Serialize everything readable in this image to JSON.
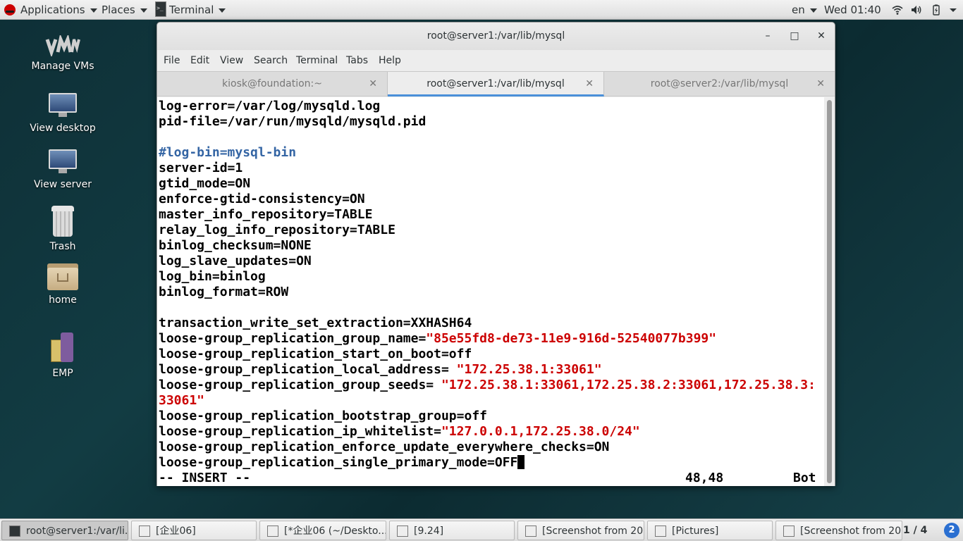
{
  "top_panel": {
    "applications_label": "Applications",
    "places_label": "Places",
    "terminal_label": "Terminal",
    "language": "en",
    "clock": "Wed 01:40"
  },
  "desktop_icons": [
    {
      "label": "Manage VMs",
      "icon": "vm-manager-icon"
    },
    {
      "label": "View desktop",
      "icon": "monitor-icon"
    },
    {
      "label": "View server",
      "icon": "monitor-icon"
    },
    {
      "label": "Trash",
      "icon": "trash-icon"
    },
    {
      "label": "home",
      "icon": "home-folder-icon"
    },
    {
      "label": "EMP",
      "icon": "emp-icon"
    }
  ],
  "window": {
    "title": "root@server1:/var/lib/mysql",
    "minimize": "–",
    "maximize": "□",
    "close": "✕"
  },
  "menu": [
    "File",
    "Edit",
    "View",
    "Search",
    "Terminal",
    "Tabs",
    "Help"
  ],
  "tabs": [
    {
      "label": "kiosk@foundation:~",
      "close": "✕"
    },
    {
      "label": "root@server1:/var/lib/mysql",
      "close": "✕"
    },
    {
      "label": "root@server2:/var/lib/mysql",
      "close": "✕"
    }
  ],
  "terminal": {
    "lines": [
      "log-error=/var/log/mysqld.log",
      "pid-file=/var/run/mysqld/mysqld.pid",
      "",
      "#log-bin=mysql-bin",
      "server-id=1",
      "gtid_mode=ON",
      "enforce-gtid-consistency=ON",
      "master_info_repository=TABLE",
      "relay_log_info_repository=TABLE",
      "binlog_checksum=NONE",
      "log_slave_updates=ON",
      "log_bin=binlog",
      "binlog_format=ROW",
      "",
      "transaction_write_set_extraction=XXHASH64",
      "loose-group_replication_group_name=",
      "\"85e55fd8-de73-11e9-916d-52540077b399\"",
      "loose-group_replication_start_on_boot=off",
      "loose-group_replication_local_address= ",
      "\"172.25.38.1:33061\"",
      "loose-group_replication_group_seeds= ",
      "\"172.25.38.1:33061,172.25.38.2:33061,172.25.38.3:",
      "33061\"",
      "loose-group_replication_bootstrap_group=off",
      "loose-group_replication_ip_whitelist=",
      "\"127.0.0.1,172.25.38.0/24\"",
      "loose-group_replication_enforce_update_everywhere_checks=ON",
      "loose-group_replication_single_primary_mode=OFF",
      "-- INSERT --",
      "48,48",
      "Bot"
    ]
  },
  "taskbar": {
    "tasks": [
      {
        "label": "root@server1:/var/li...",
        "icon": "terminal-icon"
      },
      {
        "label": "[企业06]",
        "icon": "window-icon"
      },
      {
        "label": "[*企业06 (~/Deskto...",
        "icon": "text-editor-icon"
      },
      {
        "label": "[9.24]",
        "icon": "window-icon"
      },
      {
        "label": "[Screenshot from 20...",
        "icon": "image-viewer-icon"
      },
      {
        "label": "[Pictures]",
        "icon": "folder-icon"
      },
      {
        "label": "[Screenshot from 20...",
        "icon": "image-viewer-icon"
      }
    ],
    "workspace": "1 / 4",
    "notifications": "2"
  },
  "colors": {
    "desktop_bg": "#123c43",
    "comment": "#3465a4",
    "string": "#cc0000",
    "active_tab_accent": "#4a90d9"
  }
}
